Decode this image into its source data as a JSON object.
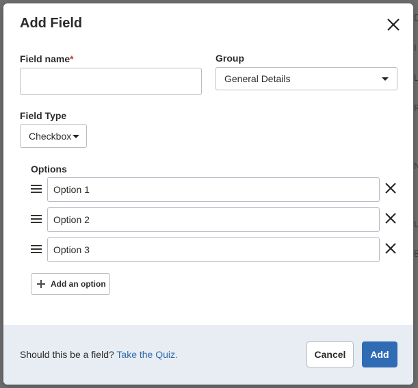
{
  "dialog": {
    "title": "Add Field"
  },
  "field_name": {
    "label": "Field name",
    "required_marker": "*",
    "value": ""
  },
  "group": {
    "label": "Group",
    "selected": "General Details"
  },
  "field_type": {
    "label": "Field Type",
    "selected": "Checkbox"
  },
  "options": {
    "label": "Options",
    "items": [
      {
        "value": "Option 1"
      },
      {
        "value": "Option 2"
      },
      {
        "value": "Option 3"
      }
    ],
    "add_label": "Add an option"
  },
  "footer": {
    "prompt": "Should this be a field?",
    "link": "Take the Quiz.",
    "cancel_label": "Cancel",
    "add_label": "Add"
  },
  "icons": {
    "close": "close-icon",
    "drag": "drag-handle-icon",
    "remove": "remove-icon",
    "plus": "plus-icon",
    "caret": "caret-down-icon"
  },
  "colors": {
    "primary": "#2f6cb4",
    "link": "#2d6aa8",
    "required": "#c0392b",
    "footer_bg": "#e8edf4"
  }
}
